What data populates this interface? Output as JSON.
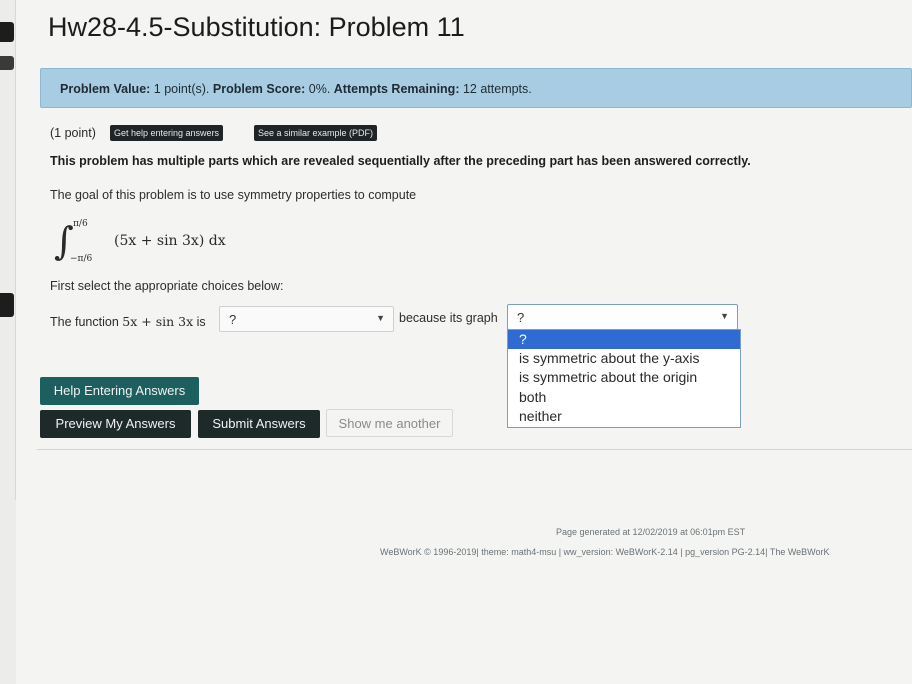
{
  "page": {
    "title": "Hw28-4.5-Substitution: Problem 11"
  },
  "info": {
    "value_label": "Problem Value:",
    "value_text": "1 point(s).",
    "score_label": "Problem Score:",
    "score_text": "0%.",
    "attempts_label": "Attempts Remaining:",
    "attempts_text": "12 attempts."
  },
  "problem": {
    "points": "(1 point)",
    "help_link": "Get help entering answers",
    "similar_link": "See a similar example (PDF)",
    "intro_bold": "This problem has multiple parts which are revealed sequentially after the preceding part has been answered correctly.",
    "goal": "The goal of this problem is to use symmetry properties to compute",
    "integral": {
      "upper": "π/6",
      "lower": "−π/6",
      "body": "(5x + sin 3x) dx"
    },
    "instruction": "First select the appropriate choices below:",
    "q_prefix": "The function",
    "q_func": "5x + sin 3x",
    "q_is": "is",
    "select1_value": "?",
    "q_because": "because its graph",
    "select2_value": "?",
    "dropdown_options": [
      "?",
      "is symmetric about the y-axis",
      "is symmetric about the origin",
      "both",
      "neither"
    ]
  },
  "buttons": {
    "help_entering": "Help Entering Answers",
    "preview": "Preview My Answers",
    "submit": "Submit Answers",
    "show_another": "Show me another"
  },
  "footer": {
    "generated": "Page generated at 12/02/2019 at 06:01pm EST",
    "credits": "WeBWorK © 1996-2019| theme: math4-msu | ww_version: WeBWorK-2.14 | pg_version PG-2.14| The WeBWorK"
  },
  "colors": {
    "info_box": "#a8cde3",
    "button_green": "#1d5e5e",
    "button_dark": "#1e2a2a",
    "dropdown_selected": "#2f6bd0"
  }
}
